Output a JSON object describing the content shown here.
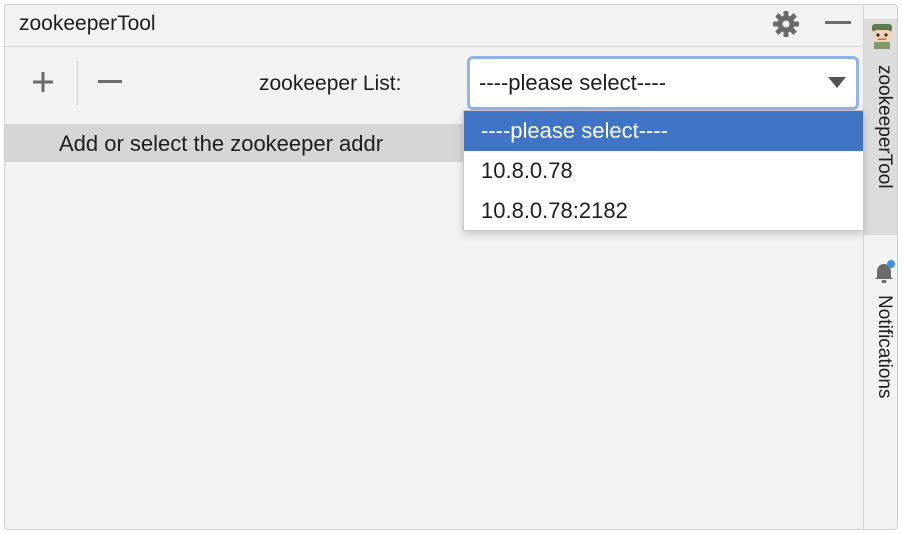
{
  "window": {
    "title": "zookeeperTool",
    "title_icons": [
      "gear-icon",
      "minimize-icon"
    ]
  },
  "toolbar": {
    "add_icon": "plus-icon",
    "remove_icon": "minus-icon",
    "list_label": "zookeeper List:",
    "combo_value": "----please select----"
  },
  "content": {
    "hint": "Add or select the zookeeper addr"
  },
  "dropdown": {
    "options": [
      {
        "label": "----please select----",
        "selected": true
      },
      {
        "label": "10.8.0.78",
        "selected": false
      },
      {
        "label": "10.8.0.78:2182",
        "selected": false
      }
    ]
  },
  "side_strip": {
    "tabs": [
      {
        "label": "zookeeperTool",
        "icon": "avatar-icon",
        "active": true
      },
      {
        "label": "Notifications",
        "icon": "bell-icon",
        "active": false
      }
    ]
  },
  "colors": {
    "selection": "#3f74c6",
    "focus_border": "#8fb4e8",
    "background": "#f2f2f2",
    "notification_dot": "#3b8fe8"
  }
}
